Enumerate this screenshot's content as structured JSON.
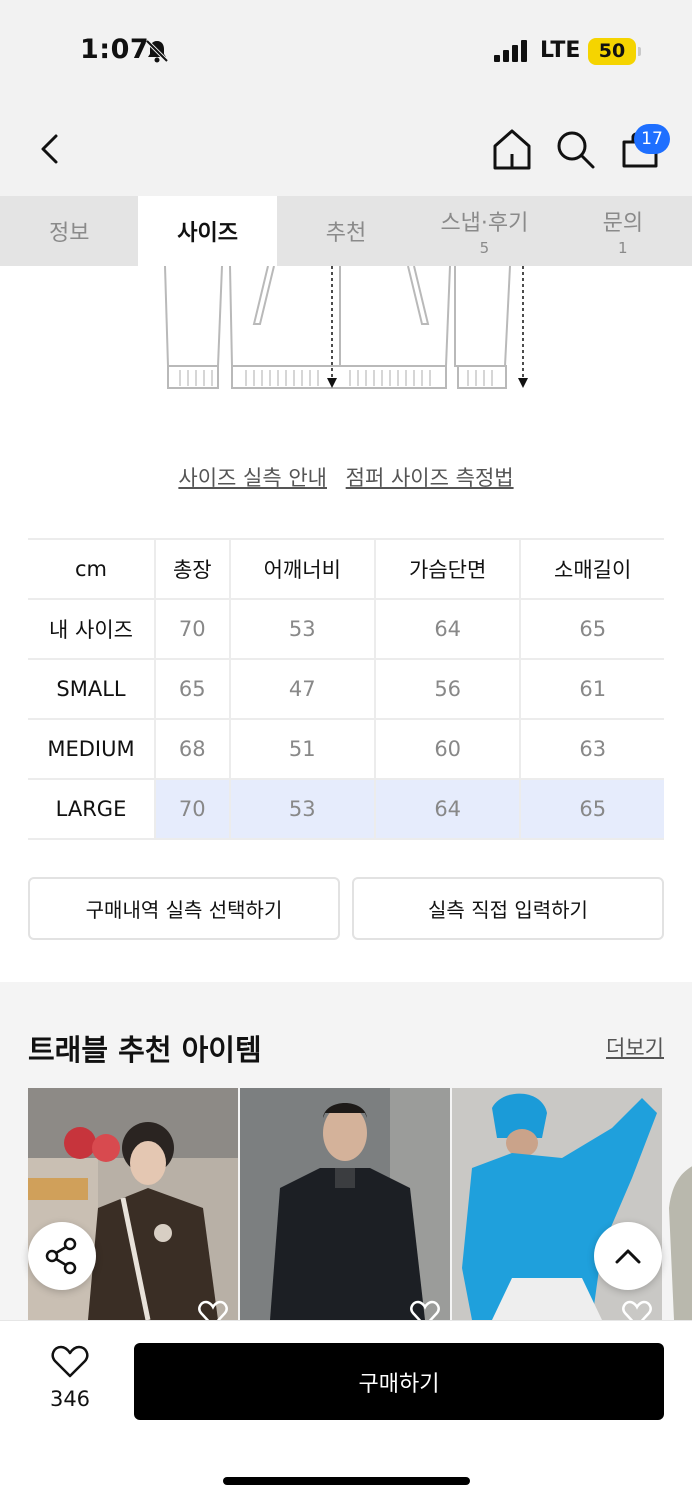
{
  "status_bar": {
    "time": "1:07",
    "network": "LTE",
    "battery": "50"
  },
  "header": {
    "cart_count": "17"
  },
  "tabs": [
    {
      "label": "정보",
      "count": ""
    },
    {
      "label": "사이즈",
      "count": ""
    },
    {
      "label": "추천",
      "count": ""
    },
    {
      "label": "스냅·후기",
      "count": "5"
    },
    {
      "label": "문의",
      "count": "1"
    }
  ],
  "guides": {
    "actual_size": "사이즈 실측 안내",
    "measure_method": "점퍼 사이즈 측정법"
  },
  "size_table": {
    "headers": [
      "cm",
      "총장",
      "어깨너비",
      "가슴단면",
      "소매길이"
    ],
    "rows": [
      [
        "내 사이즈",
        "70",
        "53",
        "64",
        "65"
      ],
      [
        "SMALL",
        "65",
        "47",
        "56",
        "61"
      ],
      [
        "MEDIUM",
        "68",
        "51",
        "60",
        "63"
      ],
      [
        "LARGE",
        "70",
        "53",
        "64",
        "65"
      ]
    ],
    "highlight_row": "LARGE",
    "highlight_color": "#e6ecfc"
  },
  "actions": {
    "select_history": "구매내역 실측 선택하기",
    "manual_input": "실측 직접 입력하기"
  },
  "recommend": {
    "title": "트래블 추천 아이템",
    "more": "더보기"
  },
  "bottom": {
    "likes": "346",
    "buy": "구매하기"
  },
  "colors": {
    "accent": "#1e6fff",
    "battery": "#f5d400",
    "buy_button": "#000000"
  }
}
